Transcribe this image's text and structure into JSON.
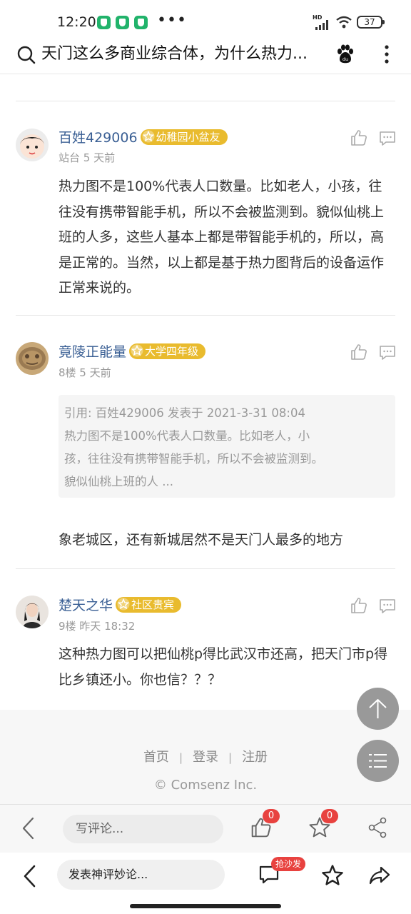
{
  "status_bar": {
    "time": "12:20",
    "dots": "•••",
    "network": "HD",
    "battery": "37"
  },
  "header": {
    "title": "天门这么多商业综合体，为什么热力..."
  },
  "posts": [
    {
      "author": "百姓429006",
      "badge": "幼稚园小盆友",
      "meta": "站台 5 天前",
      "content": "热力图不是100%代表人口数量。比如老人，小孩，往往没有携带智能手机，所以不会被监测到。貌似仙桃上班的人多，这些人基本上都是带智能手机的，所以，高是正常的。当然，以上都是基于热力图背后的设备运作正常来说的。"
    },
    {
      "author": "竟陵正能量",
      "badge": "大学四年级",
      "meta": "8楼 5 天前",
      "quote_lines": [
        "引用: 百姓429006 发表于 2021-3-31 08:04",
        "热力图不是100%代表人口数量。比如老人，小",
        "孩，往往没有携带智能手机，所以不会被监测到。",
        "貌似仙桃上班的人 ..."
      ],
      "content": "象老城区，还有新城居然不是天门人最多的地方"
    },
    {
      "author": "楚天之华",
      "badge": "社区贵宾",
      "meta": "9楼 昨天 18:32",
      "content": "这种热力图可以把仙桃p得比武汉市还高，把天门市p得比乡镇还小。你也信？？？"
    }
  ],
  "footer": {
    "links": [
      "首页",
      "登录",
      "注册"
    ],
    "separator": "|",
    "copyright": "© Comsenz Inc."
  },
  "bottom_bar": {
    "comment_placeholder": "写评论...",
    "like_count": "0",
    "favorite_count": "0"
  },
  "browser_bar": {
    "input_placeholder": "发表神评妙论...",
    "sofa_badge": "抢沙发"
  },
  "colors": {
    "author": "#3a5f94",
    "badge": "#e9bb2e",
    "count_badge": "#e8423f"
  }
}
